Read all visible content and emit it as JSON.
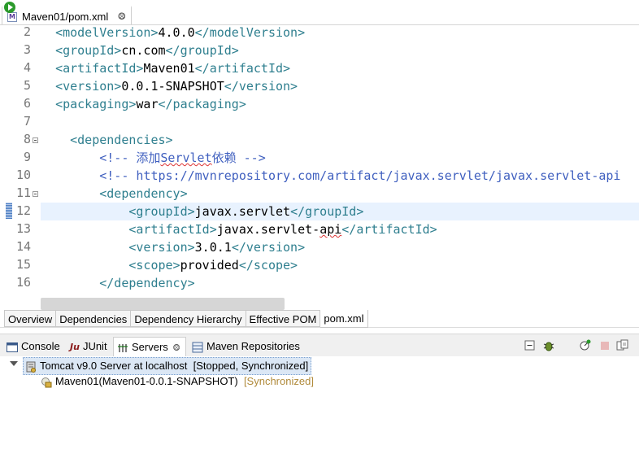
{
  "editor_tab": {
    "title": "Maven01/pom.xml",
    "close": "⨷"
  },
  "code": {
    "lines": [
      {
        "n": "2",
        "indent": "",
        "parts": [
          [
            "tag",
            "<modelVersion>"
          ],
          [
            "txt",
            "4.0.0"
          ],
          [
            "tag",
            "</modelVersion>"
          ]
        ]
      },
      {
        "n": "3",
        "indent": "",
        "parts": [
          [
            "tag",
            "<groupId>"
          ],
          [
            "txt",
            "cn.com"
          ],
          [
            "tag",
            "</groupId>"
          ]
        ]
      },
      {
        "n": "4",
        "indent": "",
        "parts": [
          [
            "tag",
            "<artifactId>"
          ],
          [
            "txt",
            "Maven01"
          ],
          [
            "tag",
            "</artifactId>"
          ]
        ]
      },
      {
        "n": "5",
        "indent": "",
        "parts": [
          [
            "tag",
            "<version>"
          ],
          [
            "txt",
            "0.0.1-SNAPSHOT"
          ],
          [
            "tag",
            "</version>"
          ]
        ]
      },
      {
        "n": "6",
        "indent": "",
        "parts": [
          [
            "tag",
            "<packaging>"
          ],
          [
            "txt",
            "war"
          ],
          [
            "tag",
            "</packaging>"
          ]
        ]
      },
      {
        "n": "7",
        "indent": "",
        "parts": []
      },
      {
        "n": "8",
        "indent": "  ",
        "fold": true,
        "parts": [
          [
            "tag",
            "<dependencies>"
          ]
        ]
      },
      {
        "n": "9",
        "indent": "      ",
        "parts": [
          [
            "cmt",
            "<!-- 添加"
          ],
          [
            "cmtsq",
            "Servlet"
          ],
          [
            "cmt",
            "依赖 -->"
          ]
        ]
      },
      {
        "n": "10",
        "indent": "      ",
        "parts": [
          [
            "cmt",
            "<!-- "
          ],
          [
            "url",
            "https://mvnrepository.com/artifact/javax.servlet/javax.servlet-api"
          ]
        ]
      },
      {
        "n": "11",
        "indent": "      ",
        "fold": true,
        "parts": [
          [
            "tag",
            "<dependency>"
          ]
        ]
      },
      {
        "n": "12",
        "indent": "          ",
        "current": true,
        "parts": [
          [
            "tag",
            "<groupId>"
          ],
          [
            "txt",
            "javax.servlet"
          ],
          [
            "tag",
            "</groupId>"
          ]
        ]
      },
      {
        "n": "13",
        "indent": "          ",
        "parts": [
          [
            "tag",
            "<artifactId>"
          ],
          [
            "txt",
            "javax.servlet-"
          ],
          [
            "txtsq",
            "api"
          ],
          [
            "tag",
            "</artifactId>"
          ]
        ]
      },
      {
        "n": "14",
        "indent": "          ",
        "parts": [
          [
            "tag",
            "<version>"
          ],
          [
            "txt",
            "3.0.1"
          ],
          [
            "tag",
            "</version>"
          ]
        ]
      },
      {
        "n": "15",
        "indent": "          ",
        "parts": [
          [
            "tag",
            "<scope>"
          ],
          [
            "txt",
            "provided"
          ],
          [
            "tag",
            "</scope>"
          ]
        ]
      },
      {
        "n": "16",
        "indent": "      ",
        "parts": [
          [
            "tag",
            "</dependency>"
          ]
        ]
      }
    ]
  },
  "pom_tabs": [
    "Overview",
    "Dependencies",
    "Dependency Hierarchy",
    "Effective POM",
    "pom.xml"
  ],
  "pom_tabs_active": "pom.xml",
  "views": {
    "tabs": [
      {
        "label": "Console",
        "icon": "console-icon"
      },
      {
        "label": "JUnit",
        "icon": "junit-icon"
      },
      {
        "label": "Servers",
        "icon": "servers-icon",
        "active": true,
        "close": "⨷"
      },
      {
        "label": "Maven Repositories",
        "icon": "maven-repositories-icon"
      }
    ]
  },
  "toolbar": {
    "icons": [
      "collapse-all-icon",
      "debug-server-icon",
      "start-server-icon",
      "profile-server-icon",
      "stop-server-icon",
      "publish-icon"
    ]
  },
  "servers": {
    "server": {
      "name": "Tomcat v9.0 Server at localhost",
      "state": "[Stopped, Synchronized]"
    },
    "module": {
      "name": "Maven01(Maven01-0.0.1-SNAPSHOT)",
      "state": "[Synchronized]"
    }
  },
  "colors": {
    "tag": "#2f7f8f",
    "comment": "#3f5fbf",
    "highlight_box": "#e02020",
    "selected_row": "#dbe7f5"
  }
}
